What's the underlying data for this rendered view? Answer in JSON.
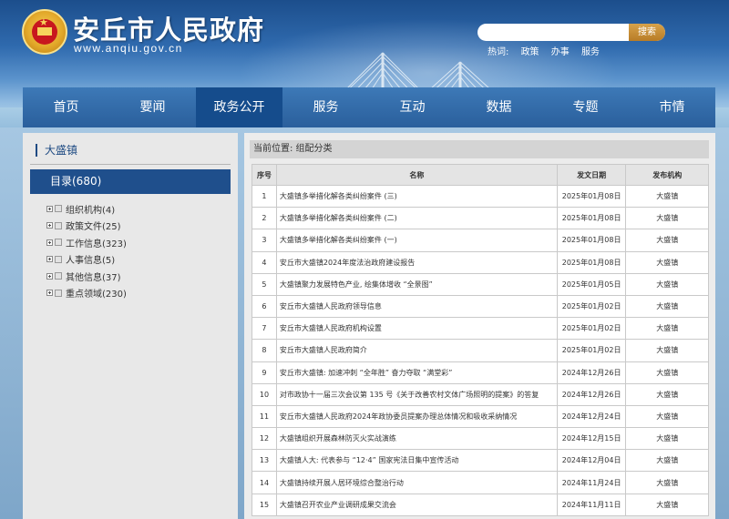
{
  "header": {
    "site_title": "安丘市人民政府",
    "site_url": "www.anqiu.gov.cn",
    "search_placeholder": "",
    "search_button": "搜索",
    "hot_label": "热词:",
    "hot_words": [
      "政策",
      "办事",
      "服务"
    ]
  },
  "nav": {
    "items": [
      "首页",
      "要闻",
      "政务公开",
      "服务",
      "互动",
      "数据",
      "专题",
      "市情"
    ],
    "active": "政务公开"
  },
  "sidebar": {
    "title": "大盛镇",
    "directory": "目录(680)",
    "tree": [
      {
        "label": "组织机构(4)"
      },
      {
        "label": "政策文件(25)"
      },
      {
        "label": "工作信息(323)"
      },
      {
        "label": "人事信息(5)"
      },
      {
        "label": "其他信息(37)"
      },
      {
        "label": "重点领域(230)"
      }
    ]
  },
  "main": {
    "breadcrumb": "当前位置: 组配分类",
    "columns": [
      "序号",
      "名称",
      "发文日期",
      "发布机构"
    ],
    "rows": [
      {
        "num": "1",
        "title": "大盛镇多举措化解各类纠纷案件 (三)",
        "date": "2025年01月08日",
        "org": "大盛镇"
      },
      {
        "num": "2",
        "title": "大盛镇多举措化解各类纠纷案件 (二)",
        "date": "2025年01月08日",
        "org": "大盛镇"
      },
      {
        "num": "3",
        "title": "大盛镇多举措化解各类纠纷案件 (一)",
        "date": "2025年01月08日",
        "org": "大盛镇"
      },
      {
        "num": "4",
        "title": "安丘市大盛镇2024年度法治政府建设报告",
        "date": "2025年01月08日",
        "org": "大盛镇"
      },
      {
        "num": "5",
        "title": "大盛镇聚力发展特色产业, 绘集体增收 “全景图”",
        "date": "2025年01月05日",
        "org": "大盛镇"
      },
      {
        "num": "6",
        "title": "安丘市大盛镇人民政府领导信息",
        "date": "2025年01月02日",
        "org": "大盛镇"
      },
      {
        "num": "7",
        "title": "安丘市大盛镇人民政府机构设置",
        "date": "2025年01月02日",
        "org": "大盛镇"
      },
      {
        "num": "8",
        "title": "安丘市大盛镇人民政府简介",
        "date": "2025年01月02日",
        "org": "大盛镇"
      },
      {
        "num": "9",
        "title": "安丘市大盛镇: 加速冲刺 “全年胜” 奋力夺取 “满堂彩”",
        "date": "2024年12月26日",
        "org": "大盛镇"
      },
      {
        "num": "10",
        "title": "对市政协十一届三次会议第 135 号《关于改善农村文体广场照明的提案》的答复",
        "date": "2024年12月26日",
        "org": "大盛镇"
      },
      {
        "num": "11",
        "title": "安丘市大盛镇人民政府2024年政协委员提案办理总体情况和吸收采纳情况",
        "date": "2024年12月24日",
        "org": "大盛镇"
      },
      {
        "num": "12",
        "title": "大盛镇组织开展森林防灭火实战演练",
        "date": "2024年12月15日",
        "org": "大盛镇"
      },
      {
        "num": "13",
        "title": "大盛镇人大: 代表参与 “12·4” 国家宪法日集中宣传活动",
        "date": "2024年12月04日",
        "org": "大盛镇"
      },
      {
        "num": "14",
        "title": "大盛镇持续开展人居环境综合整治行动",
        "date": "2024年11月24日",
        "org": "大盛镇"
      },
      {
        "num": "15",
        "title": "大盛镇召开农业产业调研成果交流会",
        "date": "2024年11月11日",
        "org": "大盛镇"
      }
    ]
  }
}
